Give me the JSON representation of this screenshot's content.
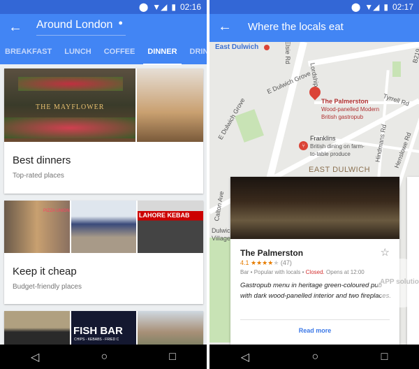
{
  "left": {
    "status": {
      "time": "02:16"
    },
    "toolbar": {
      "title": "Around London"
    },
    "tabs": [
      {
        "label": "BREAKFAST"
      },
      {
        "label": "LUNCH"
      },
      {
        "label": "COFFEE"
      },
      {
        "label": "DINNER",
        "active": true
      },
      {
        "label": "DRINKS"
      }
    ],
    "cards": [
      {
        "title": "Best dinners",
        "subtitle": "Top-rated places",
        "photo_sign": "THE MAYFLOWER"
      },
      {
        "title": "Keep it cheap",
        "subtitle": "Budget-friendly places",
        "photo_signs": [
          "PIZZA UNION",
          "LAHORE KEBAB"
        ]
      },
      {
        "photo_signs": [
          "FISH BAR",
          "CHIPS - KEBABS - FRIED C"
        ]
      }
    ]
  },
  "right": {
    "status": {
      "time": "02:17"
    },
    "toolbar": {
      "title": "Where the locals eat"
    },
    "map": {
      "labels": [
        "East Dulwich",
        "Elsie Rd",
        "E Dulwich Grove",
        "E Dulwich Grove",
        "Lordship",
        "Tyrrell Rd",
        "Hindmans Rd",
        "Henslowe Rd",
        "EAST DULWICH",
        "Calton Ave",
        "Dulwich Village",
        "B219"
      ],
      "pins": [
        {
          "name": "The Palmerston",
          "desc": "Wood-panelled Modern British gastropub",
          "icon": "map-pin-icon"
        },
        {
          "name": "Franklins",
          "desc": "British dining on farm-to-table produce",
          "icon": "restaurant-icon"
        }
      ]
    },
    "place": {
      "name": "The Palmerston",
      "rating": "4.1",
      "stars": 4,
      "reviews": "(47)",
      "category": "Bar",
      "tag": "Popular with locals",
      "status": "Closed.",
      "hours": "Opens at 12:00",
      "description": "Gastropub menu in heritage green-coloured pub with dark wood-panelled interior and two fireplaces.",
      "action": "Read more"
    },
    "watermark": "APP solution"
  },
  "colors": {
    "primary": "#4285f4",
    "status_bar": "#3367d6",
    "rating": "#e67c00",
    "closed": "#d32f2f",
    "link": "#3b78e7",
    "pin": "#db4437"
  }
}
